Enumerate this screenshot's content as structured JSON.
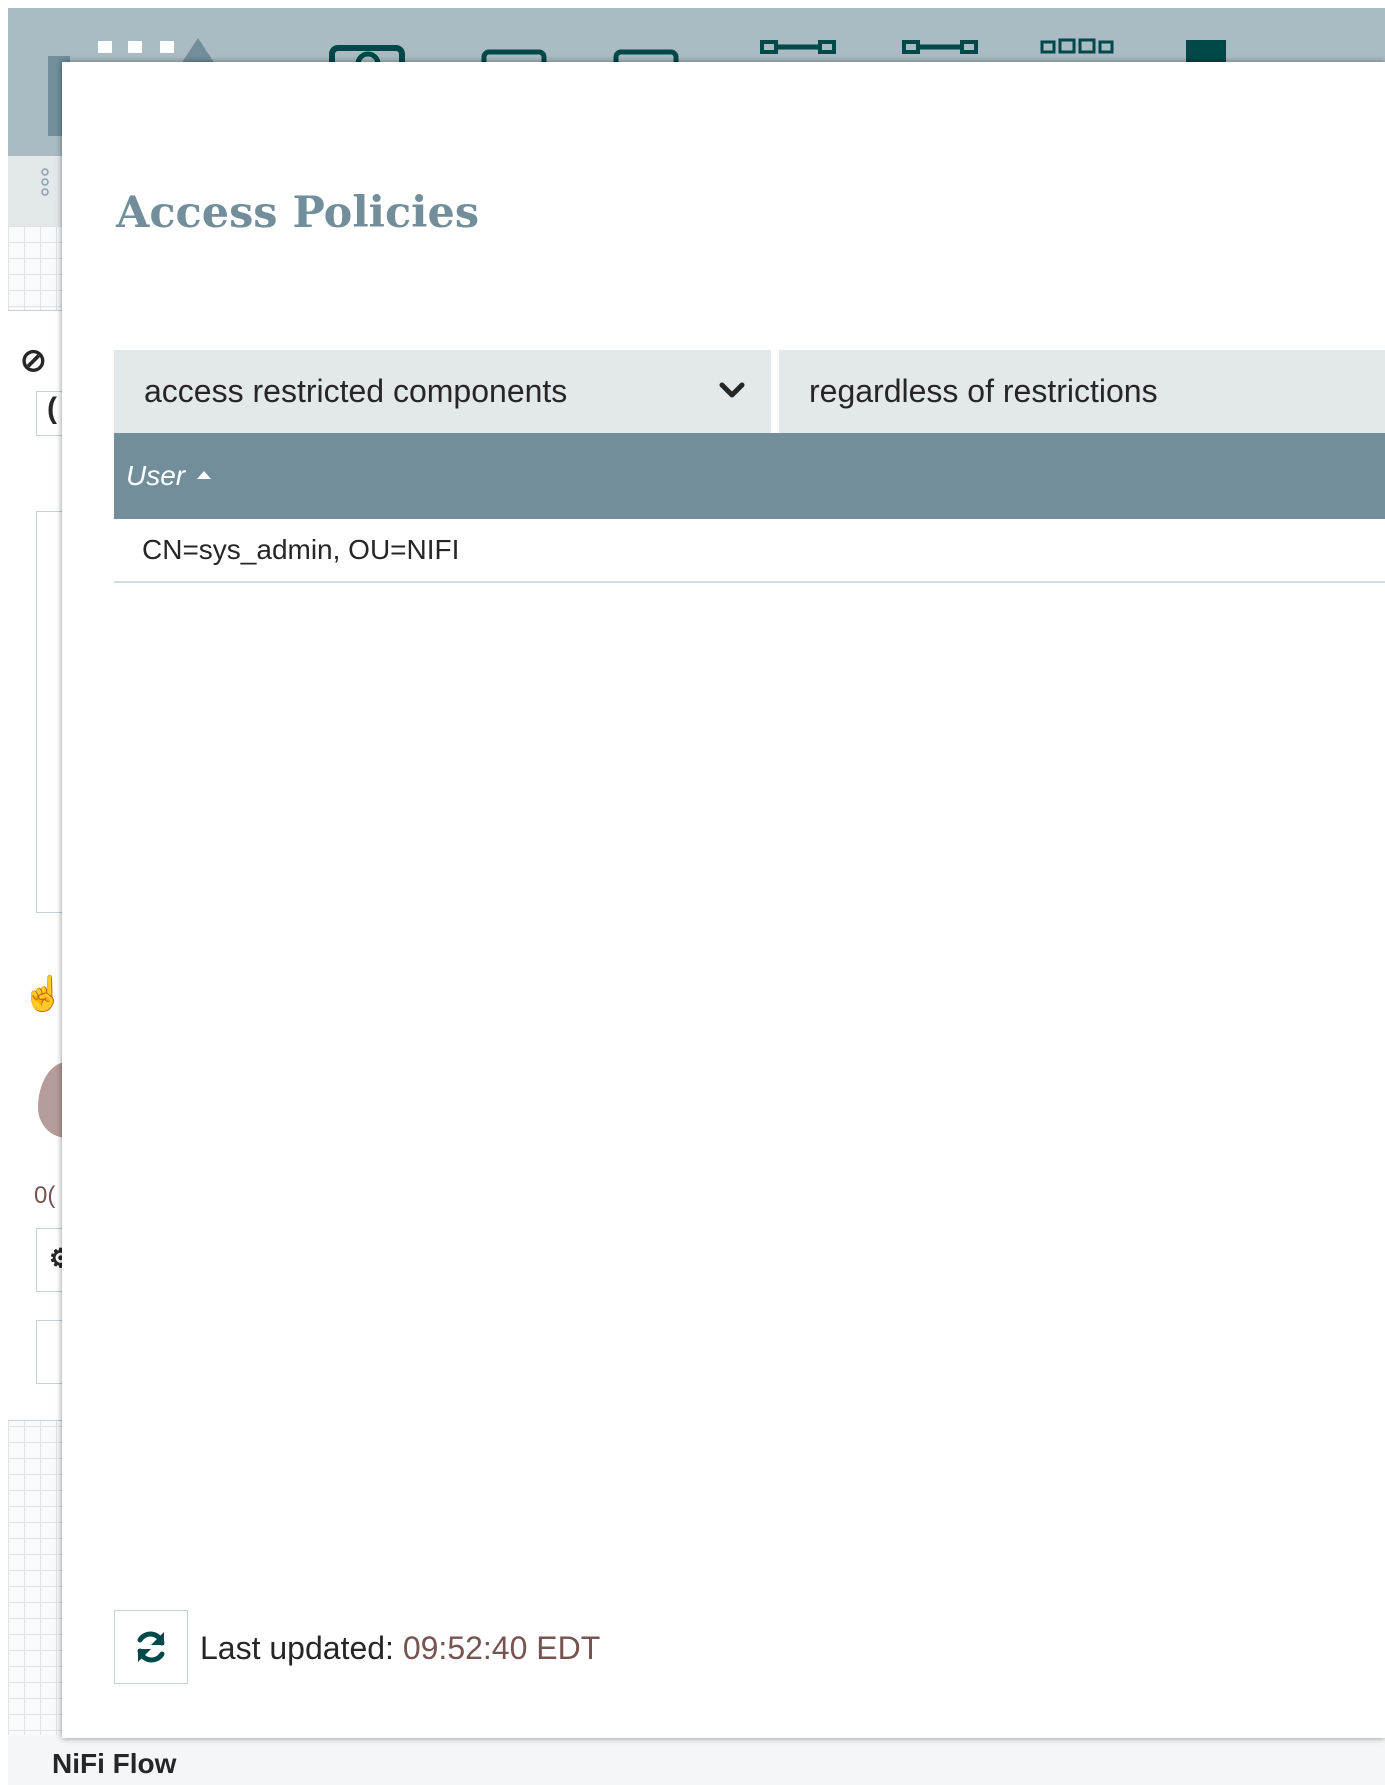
{
  "dialog": {
    "title": "Access Policies",
    "policy_select": {
      "value": "access restricted components"
    },
    "restriction_select": {
      "value": "regardless of restrictions"
    },
    "table": {
      "columns": [
        {
          "label": "User",
          "sort": "ascending"
        }
      ],
      "rows": [
        {
          "user": "CN=sys_admin, OU=NIFI"
        }
      ]
    },
    "footer": {
      "last_updated_label": "Last updated:",
      "timestamp": "09:52:40 EDT"
    }
  },
  "background": {
    "flow_name": "NiFi Flow"
  },
  "colors": {
    "accent": "#728e9b",
    "header_bg": "#aabbc3",
    "select_bg": "#e3e8eb",
    "timestamp": "#775351",
    "text": "#262626"
  }
}
